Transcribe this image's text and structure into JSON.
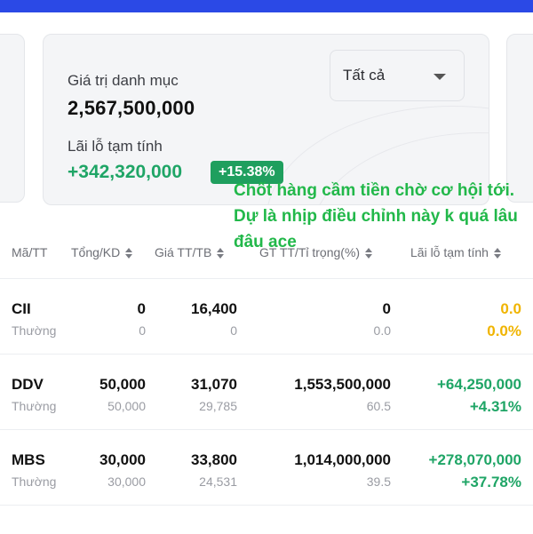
{
  "summary": {
    "portfolio_value_label": "Giá trị danh mục",
    "portfolio_value": "2,567,500,000",
    "pnl_label": "Lãi lỗ tạm tính",
    "pnl_value": "+342,320,000",
    "pnl_percent": "+15.38%",
    "filter": {
      "selected": "Tất cả"
    }
  },
  "overlay_caption": "Chốt hàng cầm tiền  chờ cơ hội tới. Dự là nhịp điều chỉnh này k quá lâu đâu ace",
  "table": {
    "headers": {
      "symbol": "Mã/TT",
      "qty": "Tổng/KD",
      "price": "Giá TT/TB",
      "value": "GT TT/Tỉ trọng(%)",
      "pnl": "Lãi lỗ tạm tính"
    },
    "rows": [
      {
        "symbol": "CII",
        "type": "Thường",
        "total": "0",
        "available": "0",
        "price_current": "16,400",
        "price_avg": "0",
        "market_value": "0",
        "weight": "0.0",
        "pnl": "0.0",
        "pnl_pct": "0.0%",
        "status": "neutral"
      },
      {
        "symbol": "DDV",
        "type": "Thường",
        "total": "50,000",
        "available": "50,000",
        "price_current": "31,070",
        "price_avg": "29,785",
        "market_value": "1,553,500,000",
        "weight": "60.5",
        "pnl": "+64,250,000",
        "pnl_pct": "+4.31%",
        "status": "gain"
      },
      {
        "symbol": "MBS",
        "type": "Thường",
        "total": "30,000",
        "available": "30,000",
        "price_current": "33,800",
        "price_avg": "24,531",
        "market_value": "1,014,000,000",
        "weight": "39.5",
        "pnl": "+278,070,000",
        "pnl_pct": "+37.78%",
        "status": "gain"
      }
    ]
  },
  "colors": {
    "header_bar": "#2b49e6",
    "gain": "#1fa566",
    "neutral": "#f0b400",
    "caption": "#22b84a"
  }
}
